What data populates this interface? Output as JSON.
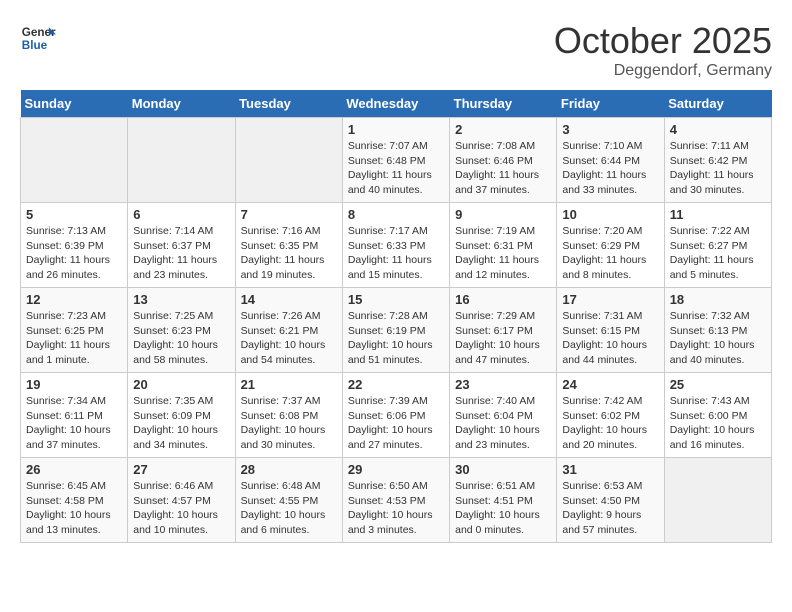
{
  "header": {
    "logo_general": "General",
    "logo_blue": "Blue",
    "month_title": "October 2025",
    "location": "Deggendorf, Germany"
  },
  "weekdays": [
    "Sunday",
    "Monday",
    "Tuesday",
    "Wednesday",
    "Thursday",
    "Friday",
    "Saturday"
  ],
  "weeks": [
    [
      {
        "day": "",
        "detail": ""
      },
      {
        "day": "",
        "detail": ""
      },
      {
        "day": "",
        "detail": ""
      },
      {
        "day": "1",
        "detail": "Sunrise: 7:07 AM\nSunset: 6:48 PM\nDaylight: 11 hours\nand 40 minutes."
      },
      {
        "day": "2",
        "detail": "Sunrise: 7:08 AM\nSunset: 6:46 PM\nDaylight: 11 hours\nand 37 minutes."
      },
      {
        "day": "3",
        "detail": "Sunrise: 7:10 AM\nSunset: 6:44 PM\nDaylight: 11 hours\nand 33 minutes."
      },
      {
        "day": "4",
        "detail": "Sunrise: 7:11 AM\nSunset: 6:42 PM\nDaylight: 11 hours\nand 30 minutes."
      }
    ],
    [
      {
        "day": "5",
        "detail": "Sunrise: 7:13 AM\nSunset: 6:39 PM\nDaylight: 11 hours\nand 26 minutes."
      },
      {
        "day": "6",
        "detail": "Sunrise: 7:14 AM\nSunset: 6:37 PM\nDaylight: 11 hours\nand 23 minutes."
      },
      {
        "day": "7",
        "detail": "Sunrise: 7:16 AM\nSunset: 6:35 PM\nDaylight: 11 hours\nand 19 minutes."
      },
      {
        "day": "8",
        "detail": "Sunrise: 7:17 AM\nSunset: 6:33 PM\nDaylight: 11 hours\nand 15 minutes."
      },
      {
        "day": "9",
        "detail": "Sunrise: 7:19 AM\nSunset: 6:31 PM\nDaylight: 11 hours\nand 12 minutes."
      },
      {
        "day": "10",
        "detail": "Sunrise: 7:20 AM\nSunset: 6:29 PM\nDaylight: 11 hours\nand 8 minutes."
      },
      {
        "day": "11",
        "detail": "Sunrise: 7:22 AM\nSunset: 6:27 PM\nDaylight: 11 hours\nand 5 minutes."
      }
    ],
    [
      {
        "day": "12",
        "detail": "Sunrise: 7:23 AM\nSunset: 6:25 PM\nDaylight: 11 hours\nand 1 minute."
      },
      {
        "day": "13",
        "detail": "Sunrise: 7:25 AM\nSunset: 6:23 PM\nDaylight: 10 hours\nand 58 minutes."
      },
      {
        "day": "14",
        "detail": "Sunrise: 7:26 AM\nSunset: 6:21 PM\nDaylight: 10 hours\nand 54 minutes."
      },
      {
        "day": "15",
        "detail": "Sunrise: 7:28 AM\nSunset: 6:19 PM\nDaylight: 10 hours\nand 51 minutes."
      },
      {
        "day": "16",
        "detail": "Sunrise: 7:29 AM\nSunset: 6:17 PM\nDaylight: 10 hours\nand 47 minutes."
      },
      {
        "day": "17",
        "detail": "Sunrise: 7:31 AM\nSunset: 6:15 PM\nDaylight: 10 hours\nand 44 minutes."
      },
      {
        "day": "18",
        "detail": "Sunrise: 7:32 AM\nSunset: 6:13 PM\nDaylight: 10 hours\nand 40 minutes."
      }
    ],
    [
      {
        "day": "19",
        "detail": "Sunrise: 7:34 AM\nSunset: 6:11 PM\nDaylight: 10 hours\nand 37 minutes."
      },
      {
        "day": "20",
        "detail": "Sunrise: 7:35 AM\nSunset: 6:09 PM\nDaylight: 10 hours\nand 34 minutes."
      },
      {
        "day": "21",
        "detail": "Sunrise: 7:37 AM\nSunset: 6:08 PM\nDaylight: 10 hours\nand 30 minutes."
      },
      {
        "day": "22",
        "detail": "Sunrise: 7:39 AM\nSunset: 6:06 PM\nDaylight: 10 hours\nand 27 minutes."
      },
      {
        "day": "23",
        "detail": "Sunrise: 7:40 AM\nSunset: 6:04 PM\nDaylight: 10 hours\nand 23 minutes."
      },
      {
        "day": "24",
        "detail": "Sunrise: 7:42 AM\nSunset: 6:02 PM\nDaylight: 10 hours\nand 20 minutes."
      },
      {
        "day": "25",
        "detail": "Sunrise: 7:43 AM\nSunset: 6:00 PM\nDaylight: 10 hours\nand 16 minutes."
      }
    ],
    [
      {
        "day": "26",
        "detail": "Sunrise: 6:45 AM\nSunset: 4:58 PM\nDaylight: 10 hours\nand 13 minutes."
      },
      {
        "day": "27",
        "detail": "Sunrise: 6:46 AM\nSunset: 4:57 PM\nDaylight: 10 hours\nand 10 minutes."
      },
      {
        "day": "28",
        "detail": "Sunrise: 6:48 AM\nSunset: 4:55 PM\nDaylight: 10 hours\nand 6 minutes."
      },
      {
        "day": "29",
        "detail": "Sunrise: 6:50 AM\nSunset: 4:53 PM\nDaylight: 10 hours\nand 3 minutes."
      },
      {
        "day": "30",
        "detail": "Sunrise: 6:51 AM\nSunset: 4:51 PM\nDaylight: 10 hours\nand 0 minutes."
      },
      {
        "day": "31",
        "detail": "Sunrise: 6:53 AM\nSunset: 4:50 PM\nDaylight: 9 hours\nand 57 minutes."
      },
      {
        "day": "",
        "detail": ""
      }
    ]
  ]
}
